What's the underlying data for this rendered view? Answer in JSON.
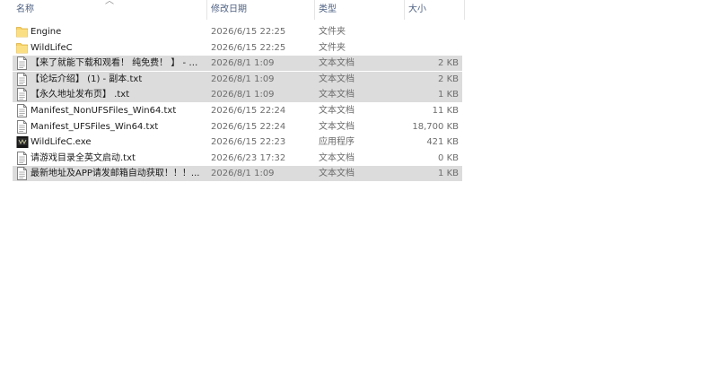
{
  "columns": {
    "name": "名称",
    "date": "修改日期",
    "type": "类型",
    "size": "大小"
  },
  "files": [
    {
      "name": "Engine",
      "date": "2026/6/15 22:25",
      "type": "文件夹",
      "size": "",
      "icon": "folder-icon",
      "selected": false
    },
    {
      "name": "WildLifeC",
      "date": "2026/6/15 22:25",
      "type": "文件夹",
      "size": "",
      "icon": "folder-icon",
      "selected": false
    },
    {
      "name": "【来了就能下载和观看！ 纯免费！ 】 - 副...",
      "date": "2026/8/1 1:09",
      "type": "文本文档",
      "size": "2 KB",
      "icon": "text-file-icon",
      "selected": true
    },
    {
      "name": "【论坛介绍】 (1) - 副本.txt",
      "date": "2026/8/1 1:09",
      "type": "文本文档",
      "size": "2 KB",
      "icon": "text-file-icon",
      "selected": true
    },
    {
      "name": "【永久地址发布页】 .txt",
      "date": "2026/8/1 1:09",
      "type": "文本文档",
      "size": "1 KB",
      "icon": "text-file-icon",
      "selected": true
    },
    {
      "name": "Manifest_NonUFSFiles_Win64.txt",
      "date": "2026/6/15 22:24",
      "type": "文本文档",
      "size": "11 KB",
      "icon": "text-file-icon",
      "selected": false
    },
    {
      "name": "Manifest_UFSFiles_Win64.txt",
      "date": "2026/6/15 22:24",
      "type": "文本文档",
      "size": "18,700 KB",
      "icon": "text-file-icon",
      "selected": false
    },
    {
      "name": "WildLifeC.exe",
      "date": "2026/6/15 22:23",
      "type": "应用程序",
      "size": "421 KB",
      "icon": "app-exe-icon",
      "selected": false
    },
    {
      "name": "请游戏目录全英文启动.txt",
      "date": "2026/6/23 17:32",
      "type": "文本文档",
      "size": "0 KB",
      "icon": "text-file-icon",
      "selected": false
    },
    {
      "name": "最新地址及APP请发邮箱自动获取！！！...",
      "date": "2026/8/1 1:09",
      "type": "文本文档",
      "size": "1 KB",
      "icon": "text-file-icon",
      "selected": true
    }
  ],
  "colors": {
    "folder": "#f7d46b",
    "selection": "#dcdcdc",
    "header_text": "#4d6082"
  }
}
